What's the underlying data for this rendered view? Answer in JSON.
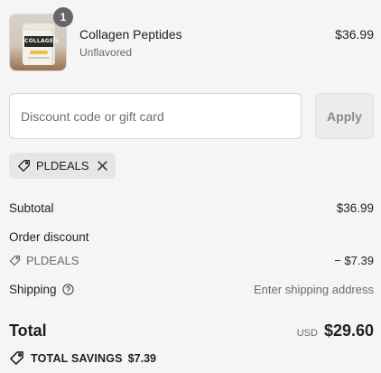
{
  "product": {
    "name": "Collagen Peptides",
    "variant": "Unflavored",
    "price": "$36.99",
    "quantity": "1",
    "image_label": "COLLAGEN"
  },
  "discount": {
    "placeholder": "Discount code or gift card",
    "value": "",
    "apply_label": "Apply",
    "applied_code": "PLDEALS"
  },
  "summary": {
    "subtotal_label": "Subtotal",
    "subtotal_value": "$36.99",
    "order_discount_label": "Order discount",
    "order_discount_code": "PLDEALS",
    "order_discount_amount": "− $7.39",
    "shipping_label": "Shipping",
    "shipping_value": "Enter shipping address",
    "total_label": "Total",
    "currency": "USD",
    "total_value": "$29.60",
    "savings_label": "TOTAL SAVINGS",
    "savings_value": "$7.39"
  },
  "icons": {
    "tag": "tag-icon",
    "close": "close-icon",
    "help": "help-circle-icon"
  },
  "colors": {
    "background": "#f5f5f5",
    "muted_text": "#6b6b6b",
    "badge": "#666666",
    "chip": "#e6e6e6"
  }
}
